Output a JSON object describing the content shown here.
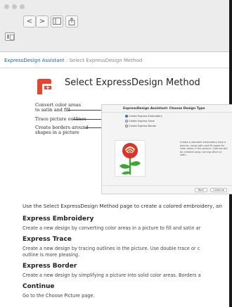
{
  "window": {
    "back_label": "<",
    "forward_label": ">",
    "share_label": "⇧"
  },
  "breadcrumb": {
    "link": "ExpressDesign Assistant",
    "separator": ":",
    "current": "Select ExpressDesign Method"
  },
  "page": {
    "title": "Select ExpressDesign Method",
    "intro": "Use the Select ExpressDesign Method page to create a colored embroidery, an"
  },
  "callouts": [
    "Convert color areas to satin and fill",
    "Trace picture outlines",
    "Create borders around shapes in a picture"
  ],
  "dialog": {
    "header": "ExpressDesign Assistant: Choose Design Type",
    "options": [
      "Create Express Embroidery",
      "Create Express Trace",
      "Create Express Border"
    ],
    "description": "Create a standard embroidery from a picture, using satin and fill areas for color areas in the picture. Outlines will be created using running stitch or satin.",
    "buttons": [
      "Back",
      "Continue"
    ]
  },
  "sections": [
    {
      "title": "Express Embroidery",
      "desc": "Create a new design by converting color areas in a picture to fill and satin ar"
    },
    {
      "title": "Express Trace",
      "desc": "Create a new design by tracing outlines in the picture. Use double trace or c"
    },
    {
      "title": "",
      "desc": "outline is more pleasing."
    },
    {
      "title": "Express Border",
      "desc": "Create a new design by simplifying a picture into solid color areas. Borders a"
    },
    {
      "title": "Continue",
      "desc": "Go to the Choose Picture page."
    }
  ],
  "colors": {
    "logo": "#e8432d",
    "link": "#1f5fbf",
    "selected_radio": "#2f6fd6"
  }
}
